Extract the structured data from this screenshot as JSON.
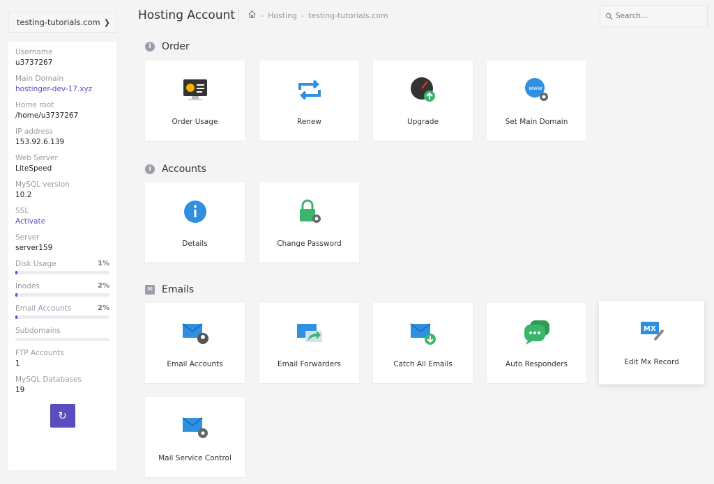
{
  "domain_select": "testing-tutorials.com",
  "header": {
    "title": "Hosting Account",
    "breadcrumb": [
      "-",
      "Hosting",
      "-",
      "testing-tutorials.com"
    ],
    "search_placeholder": "Search..."
  },
  "sidebar": {
    "info": [
      {
        "label": "Username",
        "value": "u3737267"
      },
      {
        "label": "Main Domain",
        "value": "hostinger-dev-17.xyz"
      },
      {
        "label": "Home root",
        "value": "/home/u3737267"
      },
      {
        "label": "IP address",
        "value": "153.92.6.139"
      },
      {
        "label": "Web Server",
        "value": "LiteSpeed"
      },
      {
        "label": "MySQL version",
        "value": "10.2"
      },
      {
        "label": "SSL",
        "value": "Activate"
      },
      {
        "label": "Server",
        "value": "server159"
      }
    ],
    "usage": [
      {
        "label": "Disk Usage",
        "value": "1%",
        "percent": 1
      },
      {
        "label": "Inodes",
        "value": "2%",
        "percent": 2
      },
      {
        "label": "Email Accounts",
        "value": "2%",
        "percent": 2
      },
      {
        "label": "Subdomains",
        "value": "",
        "percent": 0
      }
    ],
    "counts": [
      {
        "label": "FTP Accounts",
        "value": "1"
      },
      {
        "label": "MySQL Databases",
        "value": "19"
      }
    ]
  },
  "sections": {
    "order": {
      "title": "Order",
      "tiles": [
        "Order Usage",
        "Renew",
        "Upgrade",
        "Set Main Domain"
      ]
    },
    "accounts": {
      "title": "Accounts",
      "tiles": [
        "Details",
        "Change Password"
      ]
    },
    "emails": {
      "title": "Emails",
      "tiles": [
        "Email Accounts",
        "Email Forwarders",
        "Catch All Emails",
        "Auto Responders",
        "Edit Mx Record",
        "Mail Service Control"
      ]
    }
  },
  "colors": {
    "accent": "#5a4dbd",
    "blue": "#2f8fe0",
    "green": "#3bb56a"
  }
}
